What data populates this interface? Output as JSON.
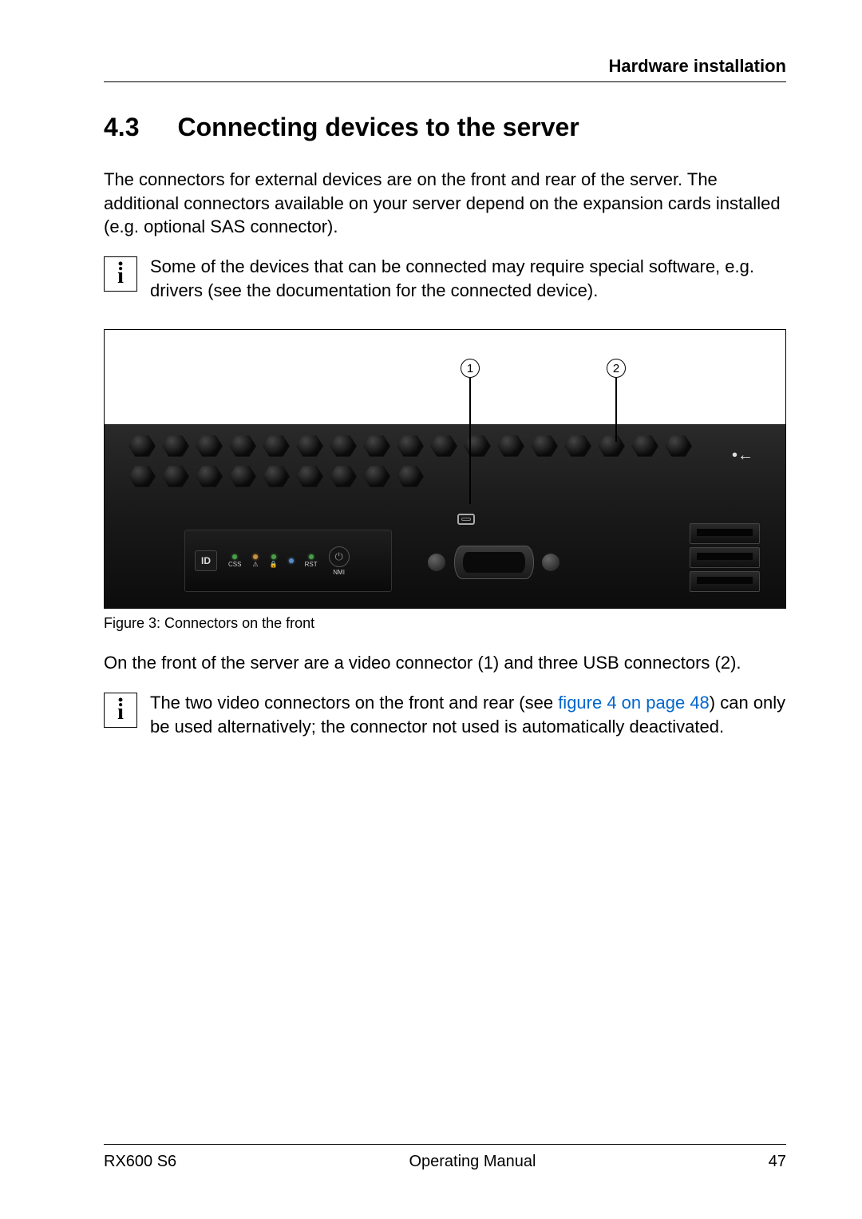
{
  "header": {
    "chapter": "Hardware installation"
  },
  "section": {
    "number": "4.3",
    "title": "Connecting devices to the server"
  },
  "para1": "The connectors for external devices are on the front and rear of the server. The additional connectors available on your server depend on the expansion cards installed (e.g. optional SAS connector).",
  "info1": "Some of the devices that can be connected may require special software, e.g. drivers (see the documentation for the connected device).",
  "figure": {
    "callout1": "1",
    "callout2": "2",
    "panel": {
      "id": "ID",
      "css": "CSS",
      "rst": "RST",
      "nmi": "NMI"
    },
    "caption": "Figure 3: Connectors on the front"
  },
  "para2": "On the front of the server are a video connector (1) and three USB connectors (2).",
  "info2_a": "The two video connectors on the front and rear (see ",
  "info2_link": "figure 4 on page 48",
  "info2_b": ") can only be used alternatively; the connector not used is automatically deactivated.",
  "footer": {
    "model": "RX600 S6",
    "doc": "Operating Manual",
    "page": "47"
  }
}
